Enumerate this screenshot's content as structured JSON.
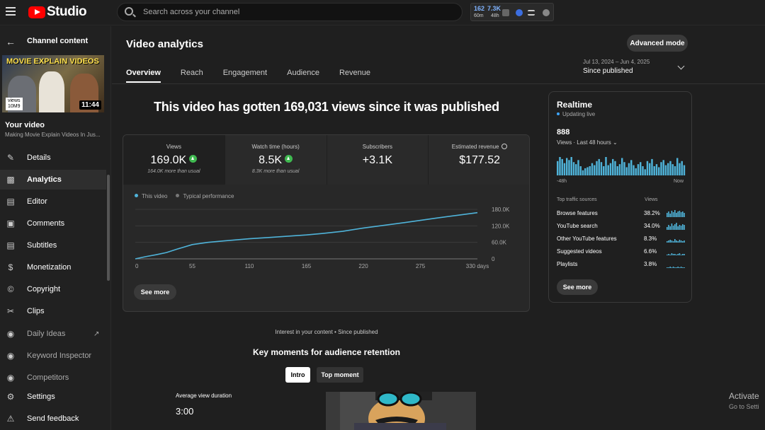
{
  "app": {
    "logo_text": "Studio",
    "search_placeholder": "Search across your channel"
  },
  "extension": {
    "n1": "162",
    "s1": "60m",
    "n2": "7.3K",
    "s2": "48h",
    "badge_color": "#ff4444"
  },
  "sidebar": {
    "back_label": "Channel content",
    "thumb_title": "MOVIE EXPLAIN VIDEOS",
    "thumb_views_label": "views",
    "thumb_views": "10M9",
    "thumb_duration": "11:44",
    "your_video": "Your video",
    "video_subtitle": "Making Movie Explain Videos In Jus...",
    "items": [
      {
        "label": "Details",
        "icon": "pencil-icon"
      },
      {
        "label": "Analytics",
        "icon": "analytics-icon"
      },
      {
        "label": "Editor",
        "icon": "film-icon"
      },
      {
        "label": "Comments",
        "icon": "comment-icon"
      },
      {
        "label": "Subtitles",
        "icon": "subtitles-icon"
      },
      {
        "label": "Monetization",
        "icon": "dollar-icon"
      },
      {
        "label": "Copyright",
        "icon": "copyright-icon"
      },
      {
        "label": "Clips",
        "icon": "scissors-icon"
      },
      {
        "label": "Daily Ideas",
        "icon": "extension-icon"
      },
      {
        "label": "Keyword Inspector",
        "icon": "extension-icon"
      },
      {
        "label": "Competitors",
        "icon": "extension-icon"
      },
      {
        "label": "Settings",
        "icon": "gear-icon"
      },
      {
        "label": "Send feedback",
        "icon": "feedback-icon"
      }
    ]
  },
  "main": {
    "title": "Video analytics",
    "advanced_mode": "Advanced mode",
    "date_range": "Jul 13, 2024 – Jun 4, 2025",
    "date_selected": "Since published",
    "tabs": [
      "Overview",
      "Reach",
      "Engagement",
      "Audience",
      "Revenue"
    ],
    "headline": "This video has gotten 169,031 views since it was published",
    "metrics": [
      {
        "label": "Views",
        "value": "169.0K",
        "sub": "164.0K more than usual"
      },
      {
        "label": "Watch time (hours)",
        "value": "8.5K",
        "sub": "8.3K more than usual"
      },
      {
        "label": "Subscribers",
        "value": "+3.1K",
        "sub": ""
      },
      {
        "label": "Estimated revenue",
        "value": "$177.52",
        "sub": ""
      }
    ],
    "legend": [
      "This video",
      "Typical performance"
    ],
    "see_more": "See more",
    "interest": "Interest in your content • Since published",
    "key_moments": "Key moments for audience retention",
    "pill_intro": "Intro",
    "pill_top": "Top moment",
    "avg_label": "Average view duration",
    "avg_value": "3:00"
  },
  "chart_data": {
    "type": "line",
    "x": [
      0,
      10,
      20,
      30,
      40,
      55,
      70,
      85,
      100,
      110,
      130,
      150,
      165,
      180,
      200,
      220,
      240,
      260,
      275,
      290,
      310,
      330
    ],
    "series": [
      {
        "name": "This video",
        "values": [
          0,
          8,
          15,
          23,
          35,
          52,
          60,
          65,
          70,
          73,
          78,
          83,
          87,
          92,
          100,
          112,
          122,
          132,
          140,
          148,
          158,
          168
        ]
      }
    ],
    "xticks": [
      "0",
      "55",
      "110",
      "165",
      "220",
      "275",
      "330 days"
    ],
    "xtick_values": [
      0,
      55,
      110,
      165,
      220,
      275,
      330
    ],
    "yticks": [
      "0",
      "60.0K",
      "120.0K",
      "180.0K"
    ],
    "ytick_values": [
      0,
      60,
      120,
      180
    ],
    "ylim": [
      0,
      180
    ],
    "xlim": [
      0,
      330
    ],
    "color": "#4fb3d9"
  },
  "realtime": {
    "title": "Realtime",
    "status": "Updating live",
    "count": "888",
    "views_label": "Views · Last 48 hours",
    "start": "-48h",
    "end": "Now",
    "sources_header": "Top traffic sources",
    "views_header": "Views",
    "sources": [
      {
        "name": "Browse features",
        "pct": "38.2%"
      },
      {
        "name": "YouTube search",
        "pct": "34.0%"
      },
      {
        "name": "Other YouTube features",
        "pct": "8.3%"
      },
      {
        "name": "Suggested videos",
        "pct": "6.6%"
      },
      {
        "name": "Playlists",
        "pct": "3.8%"
      }
    ],
    "see_more": "See more",
    "bars": [
      14,
      18,
      16,
      12,
      17,
      15,
      18,
      13,
      11,
      15,
      9,
      5,
      7,
      8,
      9,
      12,
      10,
      14,
      16,
      13,
      9,
      18,
      10,
      12,
      16,
      14,
      9,
      11,
      17,
      13,
      8,
      12,
      15,
      10,
      7,
      11,
      13,
      9,
      6,
      14,
      12,
      16,
      9,
      11,
      8,
      13,
      15,
      10,
      12,
      14,
      11,
      9,
      17,
      12,
      14,
      10
    ]
  },
  "os": {
    "activate": "Activate",
    "activate_sub": "Go to Setti"
  }
}
